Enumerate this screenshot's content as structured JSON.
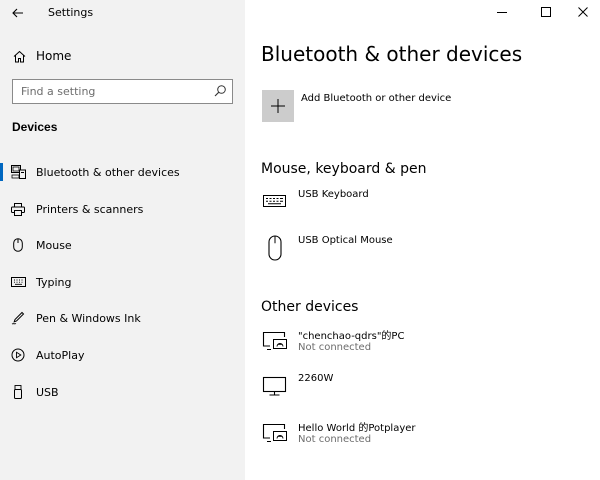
{
  "window": {
    "app_title": "Settings",
    "controls": {
      "minimize": "minimize",
      "maximize": "maximize",
      "close": "close"
    }
  },
  "sidebar": {
    "home_label": "Home",
    "search": {
      "placeholder": "Find a setting",
      "value": ""
    },
    "section_title": "Devices",
    "items": [
      {
        "label": "Bluetooth & other devices",
        "icon": "bluetooth-devices-icon",
        "selected": true
      },
      {
        "label": "Printers & scanners",
        "icon": "printer-icon",
        "selected": false
      },
      {
        "label": "Mouse",
        "icon": "mouse-icon",
        "selected": false
      },
      {
        "label": "Typing",
        "icon": "keyboard-icon",
        "selected": false
      },
      {
        "label": "Pen & Windows Ink",
        "icon": "pen-icon",
        "selected": false
      },
      {
        "label": "AutoPlay",
        "icon": "autoplay-icon",
        "selected": false
      },
      {
        "label": "USB",
        "icon": "usb-icon",
        "selected": false
      }
    ]
  },
  "main": {
    "page_title": "Bluetooth & other devices",
    "add_device_label": "Add Bluetooth or other device",
    "groups": [
      {
        "title": "Mouse, keyboard & pen",
        "devices": [
          {
            "name": "USB Keyboard",
            "status": "",
            "icon": "keyboard-icon"
          },
          {
            "name": "USB Optical Mouse",
            "status": "",
            "icon": "mouse-icon"
          }
        ]
      },
      {
        "title": "Other devices",
        "devices": [
          {
            "name": "\"chenchao-qdrs\"的PC",
            "status": "Not connected",
            "icon": "wireless-display-icon"
          },
          {
            "name": "2260W",
            "status": "",
            "icon": "monitor-icon"
          },
          {
            "name": "Hello World 的Potplayer",
            "status": "Not connected",
            "icon": "wireless-display-icon"
          }
        ]
      }
    ]
  },
  "colors": {
    "accent": "#0067c0",
    "sidebar_bg": "#f2f2f2",
    "add_tile": "#cccccc",
    "muted_text": "#6d6d6d"
  }
}
